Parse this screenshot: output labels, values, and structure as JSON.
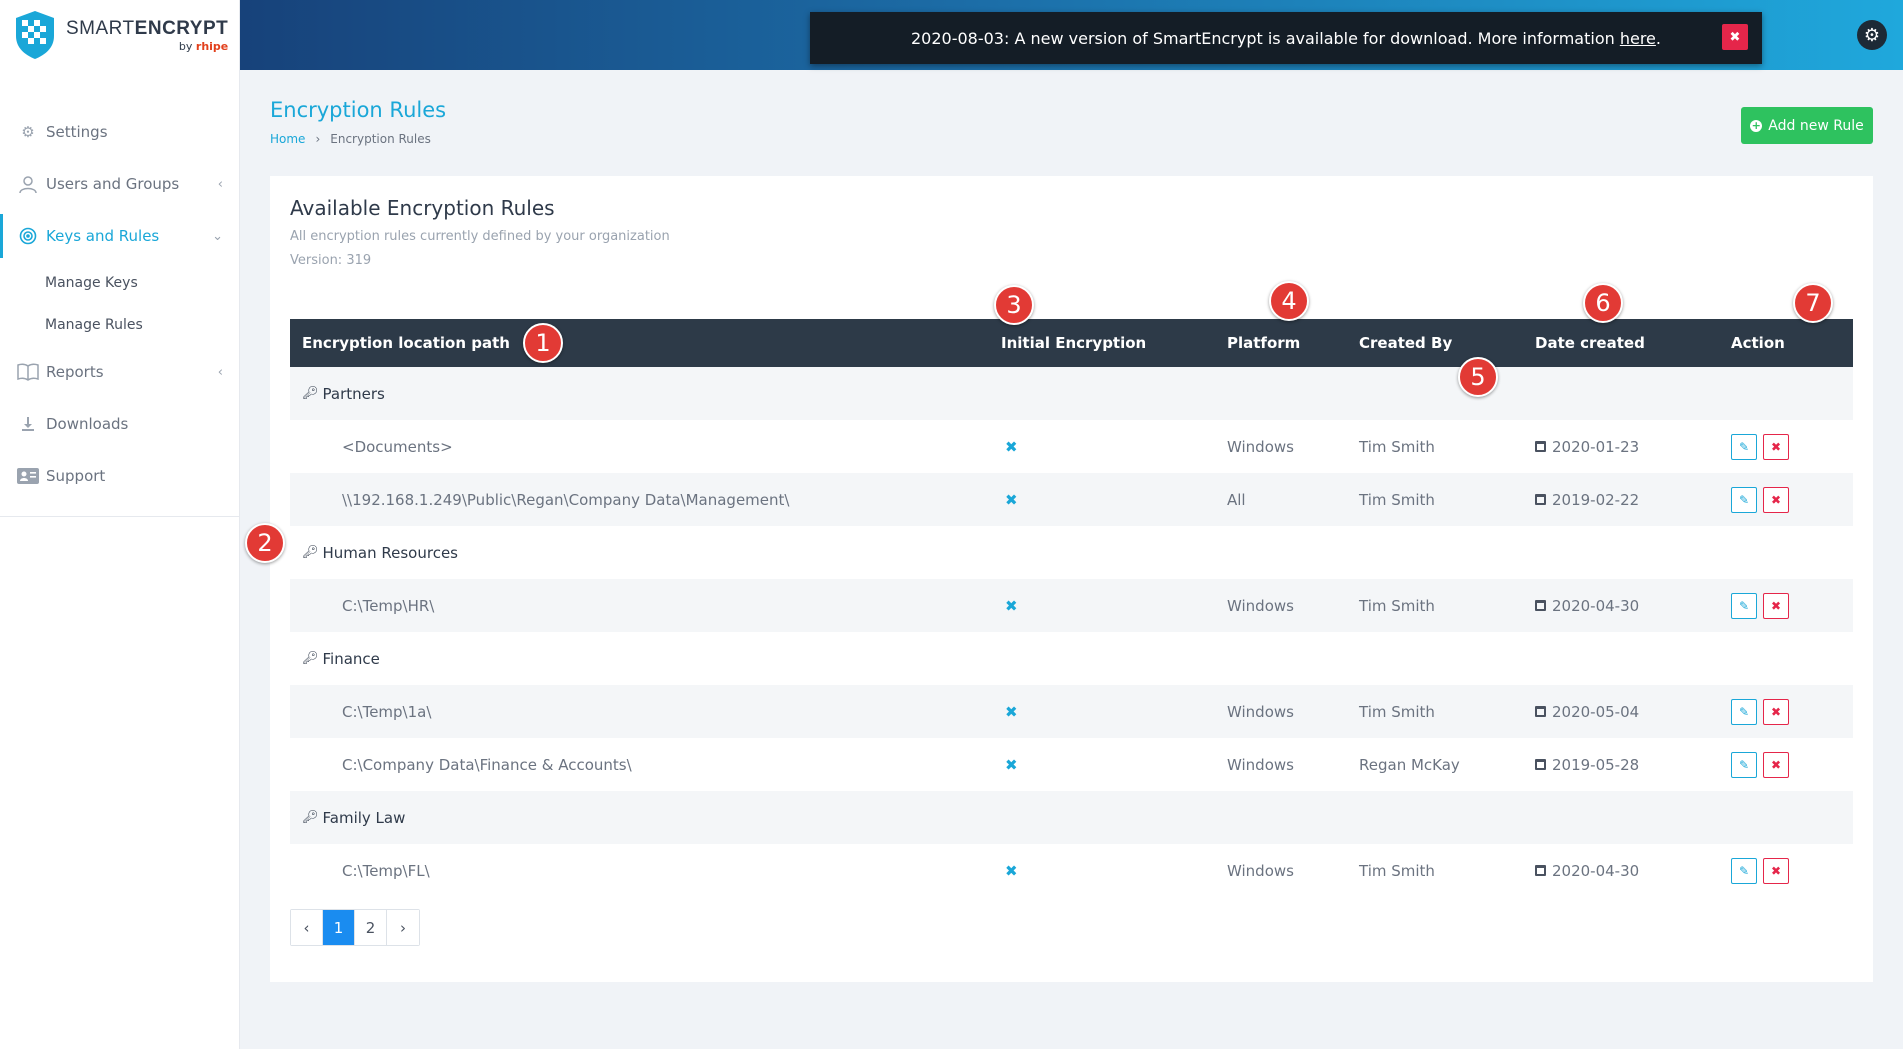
{
  "app": {
    "logo_name_light": "SMART",
    "logo_name_bold": "ENCRYPT",
    "logo_by": "by",
    "logo_by_brand": "rhipe"
  },
  "sidebar": {
    "items": [
      {
        "label": "Settings",
        "icon": "gear-icon"
      },
      {
        "label": "Users and Groups",
        "icon": "user-icon"
      },
      {
        "label": "Keys and Rules",
        "icon": "target-icon"
      },
      {
        "label": "Reports",
        "icon": "book-icon"
      },
      {
        "label": "Downloads",
        "icon": "download-icon"
      },
      {
        "label": "Support",
        "icon": "id-card-icon"
      }
    ],
    "sub_items": [
      {
        "label": "Manage Keys"
      },
      {
        "label": "Manage Rules"
      }
    ]
  },
  "notification": {
    "text": "2020-08-03: A new version of SmartEncrypt is available for download. More information ",
    "link": "here",
    "suffix": "."
  },
  "header": {
    "title": "Encryption Rules",
    "breadcrumb_home": "Home",
    "breadcrumb_current": "Encryption Rules",
    "add_button": "Add new Rule"
  },
  "card": {
    "title": "Available Encryption Rules",
    "subtitle": "All encryption rules currently defined by your organization",
    "version": "Version: 319"
  },
  "table": {
    "columns": [
      "Encryption location path",
      "Initial Encryption",
      "Platform",
      "Created By",
      "Date created",
      "Action"
    ],
    "groups": [
      {
        "name": "Partners",
        "rows": [
          {
            "path": "<Documents>",
            "initial": "✖",
            "platform": "Windows",
            "created_by": "Tim Smith",
            "date": "2020-01-23"
          },
          {
            "path": "\\\\192.168.1.249\\Public\\Regan\\Company Data\\Management\\",
            "initial": "✖",
            "platform": "All",
            "created_by": "Tim Smith",
            "date": "2019-02-22"
          }
        ]
      },
      {
        "name": "Human Resources",
        "rows": [
          {
            "path": "C:\\Temp\\HR\\",
            "initial": "✖",
            "platform": "Windows",
            "created_by": "Tim Smith",
            "date": "2020-04-30"
          }
        ]
      },
      {
        "name": "Finance",
        "rows": [
          {
            "path": "C:\\Temp\\1a\\",
            "initial": "✖",
            "platform": "Windows",
            "created_by": "Tim Smith",
            "date": "2020-05-04"
          },
          {
            "path": "C:\\Company Data\\Finance & Accounts\\",
            "initial": "✖",
            "platform": "Windows",
            "created_by": "Regan McKay",
            "date": "2019-05-28"
          }
        ]
      },
      {
        "name": "Family Law",
        "rows": [
          {
            "path": "C:\\Temp\\FL\\",
            "initial": "✖",
            "platform": "Windows",
            "created_by": "Tim Smith",
            "date": "2020-04-30"
          }
        ]
      }
    ]
  },
  "pagination": {
    "prev": "‹",
    "pages": [
      "1",
      "2"
    ],
    "next": "›",
    "current": "1"
  },
  "callouts": [
    "1",
    "2",
    "3",
    "4",
    "5",
    "6",
    "7"
  ],
  "colors": {
    "accent": "#1aa7d8",
    "success": "#2ec25f",
    "danger": "#e5264a",
    "callout": "#e23a35",
    "table_header": "#2d3a48"
  }
}
